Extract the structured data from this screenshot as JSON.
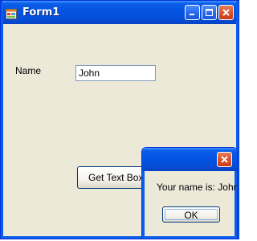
{
  "main_window": {
    "title": "Form1",
    "name_label": "Name",
    "name_value": "John",
    "get_button_label": "Get Text Box Data"
  },
  "message_box": {
    "text": "Your name is: John",
    "ok_label": "OK"
  },
  "colors": {
    "titlebar": "#0553e1",
    "window_bg": "#ece9d8",
    "close_button": "#dc5531"
  },
  "icons": {
    "app": "form-app-icon",
    "minimize": "minimize-icon",
    "maximize": "maximize-icon",
    "close": "close-icon"
  }
}
